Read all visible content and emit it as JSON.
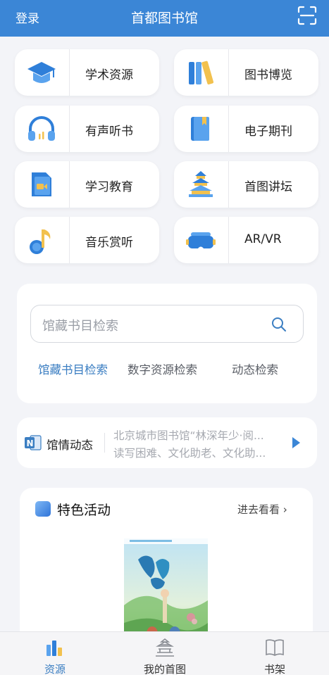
{
  "header": {
    "login": "登录",
    "title": "首都图书馆",
    "scan_icon": "scan-icon"
  },
  "grid": [
    {
      "label": "学术资源",
      "icon": "graduation-cap-icon"
    },
    {
      "label": "图书博览",
      "icon": "books-icon"
    },
    {
      "label": "有声听书",
      "icon": "headphones-icon"
    },
    {
      "label": "电子期刊",
      "icon": "journal-icon"
    },
    {
      "label": "学习教育",
      "icon": "video-tablet-icon"
    },
    {
      "label": "首图讲坛",
      "icon": "temple-icon"
    },
    {
      "label": "音乐赏听",
      "icon": "music-note-icon"
    },
    {
      "label": "AR/VR",
      "icon": "vr-headset-icon"
    }
  ],
  "search": {
    "placeholder": "馆藏书目检索",
    "tabs": [
      "馆藏书目检索",
      "数字资源检索",
      "动态检索"
    ],
    "active_tab": 0
  },
  "news": {
    "title": "馆情动态",
    "lines": [
      "北京城市图书馆“林深年少·阅...",
      "读写困难、文化助老、文化助..."
    ]
  },
  "featured": {
    "title": "特色活动",
    "more": "进去看看 ›"
  },
  "tabbar": [
    {
      "label": "资源",
      "icon": "bar-chart-icon",
      "active": true
    },
    {
      "label": "我的首图",
      "icon": "temple-icon",
      "active": false
    },
    {
      "label": "书架",
      "icon": "open-book-icon",
      "active": false
    }
  ],
  "colors": {
    "brand": "#3b86d6",
    "accent": "#3b7ec2",
    "background": "#f3f4f8"
  }
}
